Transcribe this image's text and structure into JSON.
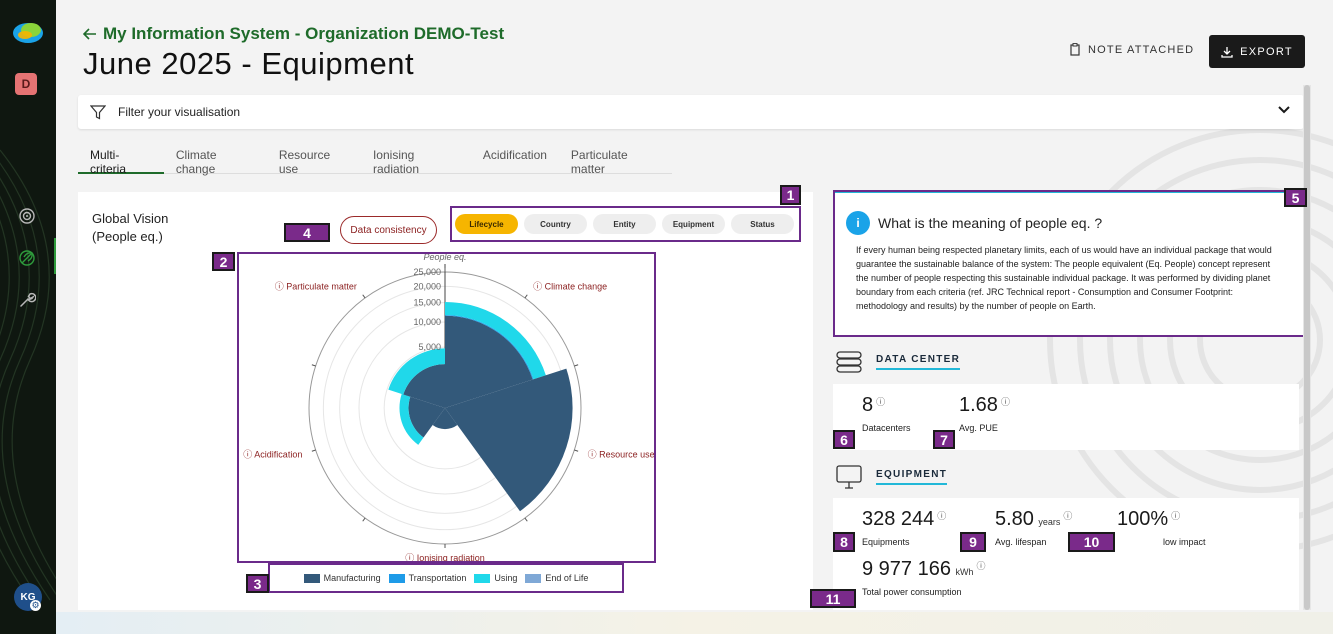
{
  "sidebar": {
    "user_initial": "D",
    "account_initials": "KG",
    "nav_icons": [
      "target-icon",
      "leaf-icon",
      "wrench-icon"
    ]
  },
  "header": {
    "back_label": "My Information System - Organization DEMO-Test",
    "title": "June 2025 - Equipment",
    "note_label": "NOTE ATTACHED",
    "export_label": "EXPORT"
  },
  "filter": {
    "label": "Filter your visualisation"
  },
  "tabs": [
    {
      "label": "Multi-criteria",
      "active": true
    },
    {
      "label": "Climate change"
    },
    {
      "label": "Resource use"
    },
    {
      "label": "Ionising radiation"
    },
    {
      "label": "Acidification"
    },
    {
      "label": "Particulate matter"
    }
  ],
  "chart_card": {
    "title_line1": "Global Vision",
    "title_line2": "(People eq.)",
    "data_consistency_label": "Data consistency",
    "group_by": [
      {
        "label": "Lifecycle",
        "active": true
      },
      {
        "label": "Country"
      },
      {
        "label": "Entity"
      },
      {
        "label": "Equipment"
      },
      {
        "label": "Status"
      }
    ]
  },
  "chart_data": {
    "type": "polar-bar-stacked",
    "radial_axis_label": "People eq.",
    "radial_ticks": [
      "25,000",
      "20,000",
      "15,000",
      "10,000",
      "5,000"
    ],
    "rlim": [
      0,
      25000
    ],
    "categories": [
      "Climate change",
      "Resource use",
      "Ionising radiation",
      "Acidification",
      "Particulate matter"
    ],
    "series": [
      {
        "name": "Manufacturing",
        "color": "#33597a",
        "values": [
          11500,
          22000,
          600,
          1800,
          2600
        ]
      },
      {
        "name": "Transportation",
        "color": "#1e9be8",
        "values": [
          200,
          0,
          0,
          0,
          0
        ]
      },
      {
        "name": "Using",
        "color": "#20d8ea",
        "values": [
          3500,
          0,
          0,
          1000,
          2200
        ]
      },
      {
        "name": "End of Life",
        "color": "#7fa8d6",
        "values": [
          0,
          0,
          0,
          0,
          0
        ]
      }
    ]
  },
  "info": {
    "title": "What is the meaning of people eq. ?",
    "text": "If every human being respected planetary limits, each of us would have an individual package that would guarantee the sustainable balance of the system: The people equivalent (Eq. People) concept represent the number of people respecting this sustainable individual package. It was performed by dividing planet boundary from each criteria (ref. JRC Technical report - Consumption and Consumer Footprint: methodology and results) by the number of people on Earth."
  },
  "datacenter": {
    "section_label": "DATA CENTER",
    "datacenters_value": "8",
    "datacenters_label": "Datacenters",
    "pue_value": "1.68",
    "pue_label": "Avg. PUE"
  },
  "equipment": {
    "section_label": "EQUIPMENT",
    "equipments_value": "328 244",
    "equipments_label": "Equipments",
    "lifespan_value": "5.80",
    "lifespan_unit": "years",
    "lifespan_label": "Avg. lifespan",
    "low_impact_value": "100%",
    "low_impact_label": "low impact",
    "power_value": "9 977 166",
    "power_unit": "kWh",
    "power_label": "Total power consumption"
  },
  "annotations": [
    "1",
    "2",
    "3",
    "4",
    "5",
    "6",
    "7",
    "8",
    "9",
    "10",
    "11"
  ]
}
